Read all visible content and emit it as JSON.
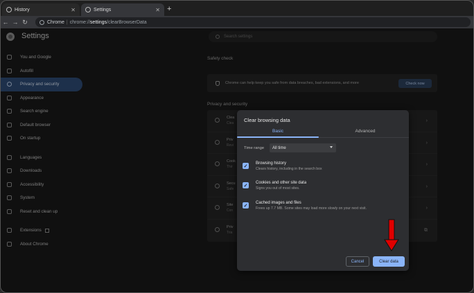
{
  "tabs": [
    {
      "label": "History"
    },
    {
      "label": "Settings"
    }
  ],
  "omnibox": {
    "host": "Chrome",
    "sep": "|",
    "prefix": "chrome://",
    "bold": "settings",
    "suffix": "/clearBrowserData"
  },
  "header": {
    "title": "Settings",
    "search_placeholder": "Search settings"
  },
  "sidebar": {
    "items": [
      {
        "label": "You and Google"
      },
      {
        "label": "Autofill"
      },
      {
        "label": "Privacy and security"
      },
      {
        "label": "Appearance"
      },
      {
        "label": "Search engine"
      },
      {
        "label": "Default browser"
      },
      {
        "label": "On startup"
      },
      {
        "label": "Languages"
      },
      {
        "label": "Downloads"
      },
      {
        "label": "Accessibility"
      },
      {
        "label": "System"
      },
      {
        "label": "Reset and clean up"
      },
      {
        "label": "Extensions"
      },
      {
        "label": "About Chrome"
      }
    ]
  },
  "main": {
    "safety_title": "Safety check",
    "safety_text": "Chrome can help keep you safe from data breaches, bad extensions, and more",
    "check_now": "Check now",
    "privacy_title": "Privacy and security",
    "rows": [
      {
        "title": "Clea",
        "sub": "Clea"
      },
      {
        "title": "Priv",
        "sub": "Revi"
      },
      {
        "title": "Cook",
        "sub": "Thir"
      },
      {
        "title": "Secu",
        "sub": "Safe"
      },
      {
        "title": "Site",
        "sub": "Con"
      },
      {
        "title": "Priv",
        "sub": "Tria"
      }
    ]
  },
  "dialog": {
    "title": "Clear browsing data",
    "tab_basic": "Basic",
    "tab_advanced": "Advanced",
    "time_range_label": "Time range",
    "time_range_value": "All time",
    "options": [
      {
        "title": "Browsing history",
        "sub": "Clears history, including in the search box",
        "checked": true
      },
      {
        "title": "Cookies and other site data",
        "sub": "Signs you out of most sites.",
        "checked": true
      },
      {
        "title": "Cached images and files",
        "sub": "Frees up 7.7 MB. Some sites may load more slowly on your next visit.",
        "checked": true
      }
    ],
    "cancel": "Cancel",
    "clear": "Clear data"
  },
  "colors": {
    "accent": "#8ab4f8",
    "annotation_arrow": "#e00000",
    "sidebar_active": "#2d4a74"
  }
}
